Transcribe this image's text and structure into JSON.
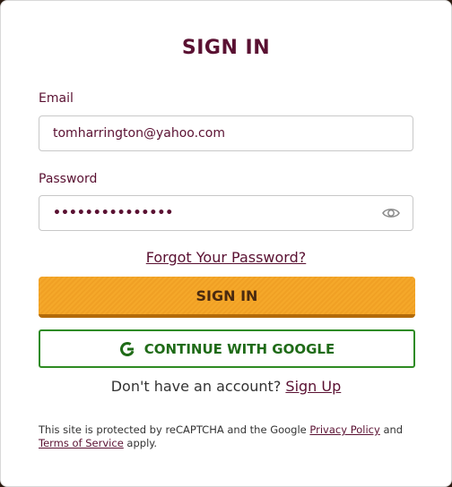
{
  "title": "SIGN IN",
  "email": {
    "label": "Email",
    "value": "tomharrington@yahoo.com"
  },
  "password": {
    "label": "Password",
    "masked_value": "•••••••••••••••",
    "icon": "eye-icon"
  },
  "forgot_link": "Forgot Your Password?",
  "signin_button": "SIGN IN",
  "google_button": {
    "label": "CONTINUE WITH GOOGLE",
    "icon": "google-icon"
  },
  "signup": {
    "prompt": "Don't have an account?",
    "link": "Sign Up"
  },
  "legal": {
    "prefix": "This site is protected by reCAPTCHA and the Google",
    "privacy": "Privacy Policy",
    "and": "and",
    "terms": "Terms of Service",
    "suffix": "apply."
  },
  "colors": {
    "brand": "#5a1132",
    "primary_button": "#f5a82a",
    "google_green": "#2e8b22"
  }
}
